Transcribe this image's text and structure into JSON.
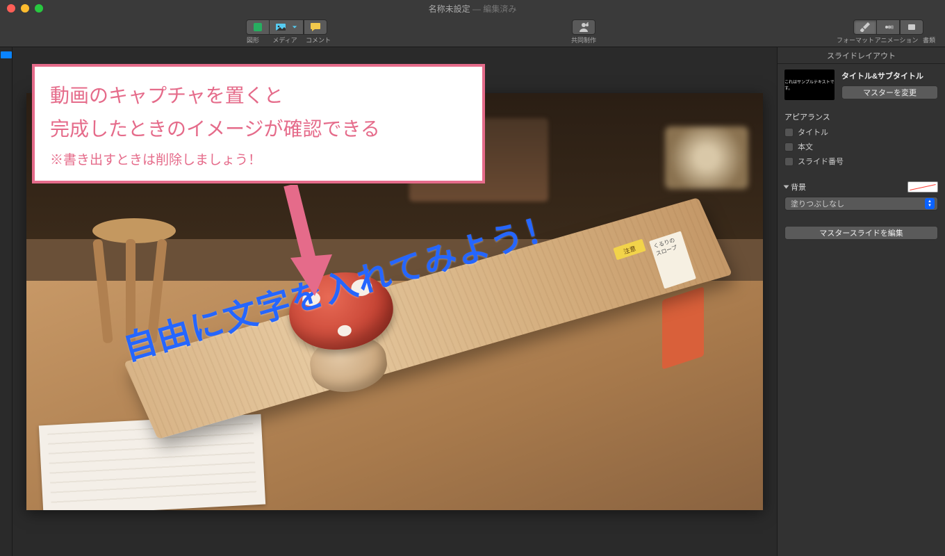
{
  "window": {
    "title": "名称未設定",
    "status": "編集済み"
  },
  "toolbar": {
    "shape": "図形",
    "media": "メディア",
    "comment": "コメント",
    "collab": "共同制作",
    "format": "フォーマット",
    "anim": "アニメーション",
    "doc": "書類"
  },
  "canvas": {
    "overlay_text": "自由に文字を入れてみよう！",
    "callout_line1": "動画のキャプチャを置くと",
    "callout_line2": "完成したときのイメージが確認できる",
    "callout_note": "※書き出すときは削除しましょう！",
    "sticker_hint": "注意",
    "sticker_label": "くるりの\nスロープ"
  },
  "inspector": {
    "subhead": "スライドレイアウト",
    "master_thumb_text": "これはサンプルテキストです。",
    "master_name": "タイトル&サブタイトル",
    "change_master": "マスターを変更",
    "appearance": "アピアランス",
    "chk_title": "タイトル",
    "chk_body": "本文",
    "chk_slidenum": "スライド番号",
    "background": "背景",
    "fill_none": "塗りつぶしなし",
    "edit_master": "マスタースライドを編集"
  }
}
